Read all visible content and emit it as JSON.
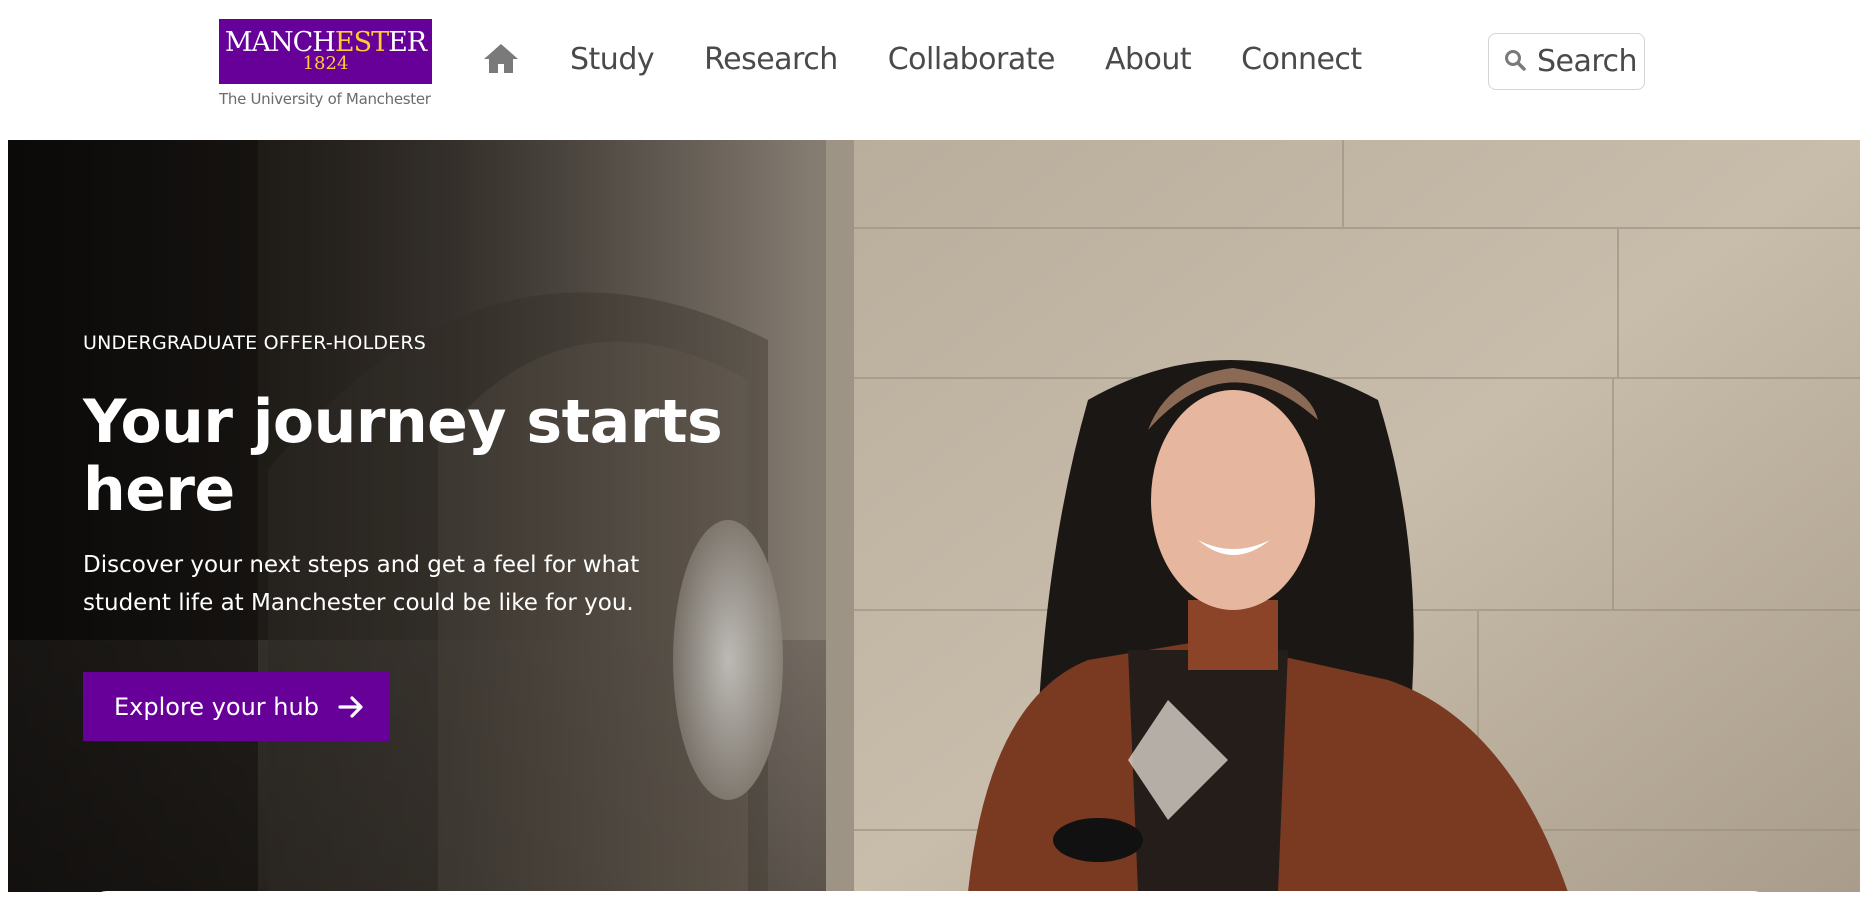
{
  "header": {
    "logo": {
      "wordmark_pre": "MANCH",
      "wordmark_mid": "EST",
      "wordmark_post": "ER",
      "year": "1824",
      "subtitle": "The University of Manchester",
      "brand_color": "#660099",
      "accent_color": "#FFCC33"
    },
    "home_icon": "home-icon",
    "nav": [
      {
        "label": "Study"
      },
      {
        "label": "Research"
      },
      {
        "label": "Collaborate"
      },
      {
        "label": "About"
      },
      {
        "label": "Connect"
      }
    ],
    "search": {
      "label": "Search",
      "icon": "search-icon"
    }
  },
  "hero": {
    "eyebrow": "UNDERGRADUATE OFFER-HOLDERS",
    "headline": "Your journey starts here",
    "description": "Discover your next steps and get a feel for what student life at Manchester could be like for you.",
    "cta": {
      "label": "Explore your hub",
      "icon": "arrow-right-icon"
    },
    "image": "photo-student-smiling-in-stone-archway"
  }
}
